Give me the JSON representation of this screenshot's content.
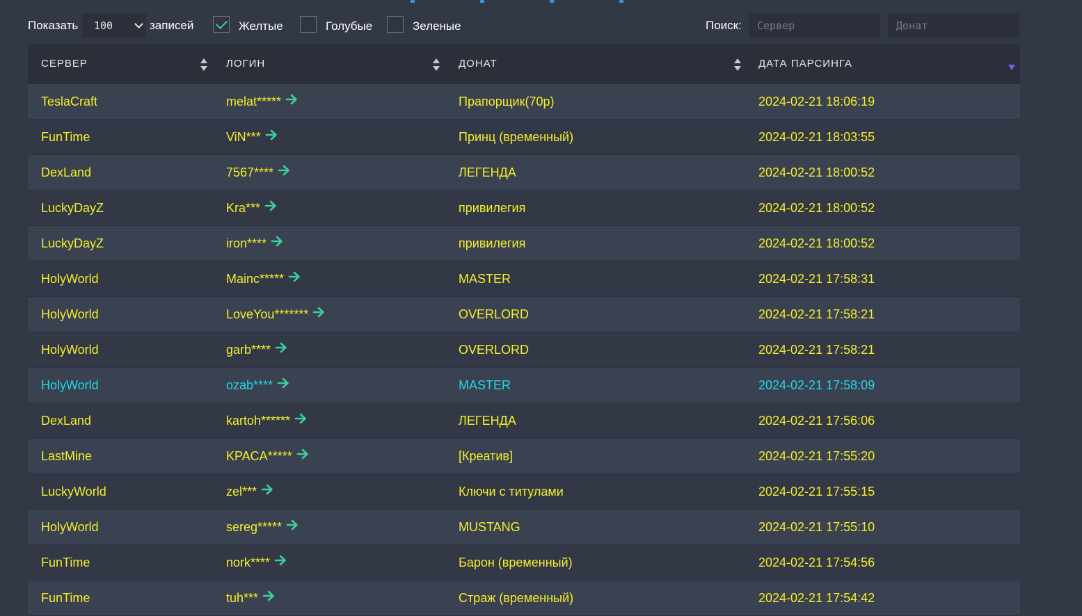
{
  "controls": {
    "show_label": "Показать",
    "show_value": "100",
    "entries_label": "записей",
    "filters": [
      {
        "label": "Желтые",
        "checked": true
      },
      {
        "label": "Голубые",
        "checked": false
      },
      {
        "label": "Зеленые",
        "checked": false
      }
    ],
    "search_label": "Поиск:",
    "search_server_placeholder": "Сервер",
    "search_donat_placeholder": "Донат"
  },
  "table": {
    "headers": {
      "server": "СЕРВЕР",
      "login": "ЛОГИН",
      "donat": "ДОНАТ",
      "date": "ДАТА ПАРСИНГА"
    },
    "colors": {
      "yellow": "#f4ee2a",
      "blue": "#22d8e8",
      "arrow": "#3ccf99"
    },
    "rows": [
      {
        "server": "TeslaCraft",
        "login": "melat*****",
        "donat": "Прапорщик(70р)",
        "date": "2024-02-21 18:06:19",
        "color": "yellow"
      },
      {
        "server": "FunTime",
        "login": "ViN***",
        "donat": "Принц (временный)",
        "date": "2024-02-21 18:03:55",
        "color": "yellow"
      },
      {
        "server": "DexLand",
        "login": "7567****",
        "donat": "ЛЕГЕНДА",
        "date": "2024-02-21 18:00:52",
        "color": "yellow"
      },
      {
        "server": "LuckyDayZ",
        "login": "Kra***",
        "donat": "привилегия",
        "date": "2024-02-21 18:00:52",
        "color": "yellow"
      },
      {
        "server": "LuckyDayZ",
        "login": "iron****",
        "donat": "привилегия",
        "date": "2024-02-21 18:00:52",
        "color": "yellow"
      },
      {
        "server": "HolyWorld",
        "login": "Mainc*****",
        "donat": "MASTER",
        "date": "2024-02-21 17:58:31",
        "color": "yellow"
      },
      {
        "server": "HolyWorld",
        "login": "LoveYou*******",
        "donat": "OVERLORD",
        "date": "2024-02-21 17:58:21",
        "color": "yellow"
      },
      {
        "server": "HolyWorld",
        "login": "garb****",
        "donat": "OVERLORD",
        "date": "2024-02-21 17:58:21",
        "color": "yellow"
      },
      {
        "server": "HolyWorld",
        "login": "ozab****",
        "donat": "MASTER",
        "date": "2024-02-21 17:58:09",
        "color": "blue"
      },
      {
        "server": "DexLand",
        "login": "kartoh******",
        "donat": "ЛЕГЕНДА",
        "date": "2024-02-21 17:56:06",
        "color": "yellow"
      },
      {
        "server": "LastMine",
        "login": "KPACA*****",
        "donat": "[Креатив]",
        "date": "2024-02-21 17:55:20",
        "color": "yellow"
      },
      {
        "server": "LuckyWorld",
        "login": "zel***",
        "donat": "Ключи с титулами",
        "date": "2024-02-21 17:55:15",
        "color": "yellow"
      },
      {
        "server": "HolyWorld",
        "login": "sereg*****",
        "donat": "MUSTANG",
        "date": "2024-02-21 17:55:10",
        "color": "yellow"
      },
      {
        "server": "FunTime",
        "login": "nork****",
        "donat": "Барон (временный)",
        "date": "2024-02-21 17:54:56",
        "color": "yellow"
      },
      {
        "server": "FunTime",
        "login": "tuh***",
        "donat": "Страж (временный)",
        "date": "2024-02-21 17:54:42",
        "color": "yellow"
      }
    ]
  }
}
